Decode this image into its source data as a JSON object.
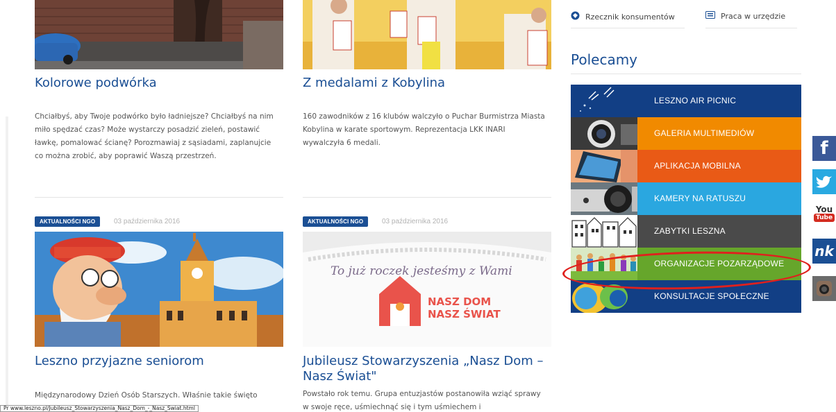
{
  "articles": [
    {
      "title": "Kolorowe podwórka",
      "text": "Chciałbyś, aby Twoje podwórko było ładniejsze? Chciałbyś na nim miło spędzać czas? Może wystarczy posadzić zieleń, postawić ławkę, pomalować ścianę? Porozmawiaj z sąsiadami, zaplanujcie co można zrobić, aby poprawić Waszą przestrzeń."
    },
    {
      "title": "Z medalami z Kobylina",
      "text": "160 zawodników z 16 klubów walczyło o Puchar Burmistrza Miasta Kobylina w karate sportowym. Reprezentacja LKK INARI wywalczyła 6 medali."
    },
    {
      "badge": "AKTUALNOŚCI NGO",
      "date": "03 października 2016",
      "title": "Leszno przyjazne seniorom",
      "text": "Międzynarodowy Dzień Osób Starszych. Właśnie takie święto"
    },
    {
      "badge": "AKTUALNOŚCI NGO",
      "date": "03 października 2016",
      "title": "Jubileusz Stowarzyszenia „Nasz Dom – Nasz Świat\"",
      "text": "Powstało rok temu. Grupa entuzjastów postanowiła wziąć sprawy w swoje ręce, uśmiechnąć się i tym uśmiechem i",
      "image_text": {
        "handwriting": "To już roczek jesteśmy z Wami",
        "logo_line1": "NASZ DOM",
        "logo_line2": "NASZ ŚWIAT"
      }
    }
  ],
  "top_links": [
    {
      "label": "Rzecznik konsumentów",
      "icon": "shield-icon"
    },
    {
      "label": "Praca w urzędzie",
      "icon": "id-card-icon"
    }
  ],
  "recommended": {
    "title": "Polecamy",
    "tiles": [
      {
        "label": "LESZNO AIR PICNIC",
        "color": "#123f85"
      },
      {
        "label": "GALERIA MULTIMEDIÓW",
        "color": "#f18a00"
      },
      {
        "label": "APLIKACJA MOBILNA",
        "color": "#e95a16"
      },
      {
        "label": "KAMERY NA RATUSZU",
        "color": "#2aa7e0"
      },
      {
        "label": "ZABYTKI LESZNA",
        "color": "#4a4a4a"
      },
      {
        "label": "ORGANIZACJE POZARZĄDOWE",
        "color": "#66a62b"
      },
      {
        "label": "KONSULTACJE SPOŁECZNE",
        "color": "#123f85"
      }
    ]
  },
  "social": [
    {
      "label": "f",
      "icon": "facebook-icon",
      "color": "#3b5998"
    },
    {
      "label": "",
      "icon": "twitter-icon",
      "color": "#29a9e1"
    },
    {
      "label": "You",
      "label2": "Tube",
      "icon": "youtube-icon",
      "color": "#ffffff"
    },
    {
      "label": "nk",
      "icon": "nk-icon",
      "color": "#1b4f94"
    },
    {
      "label": "",
      "icon": "instagram-icon",
      "color": "#6b6b6b"
    }
  ],
  "statusbar": "Pr www.leszno.pl/Jubileusz_Stowarzyszenia_Nasz_Dom_-_Nasz_Swiat.html"
}
